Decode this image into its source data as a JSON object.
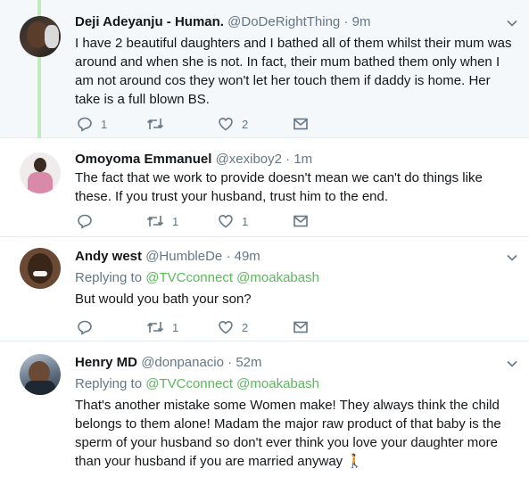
{
  "tweets": [
    {
      "name": "Deji Adeyanju - Human.",
      "handle": "@DoDeRightThing",
      "time": "· 9m",
      "text": "I have 2 beautiful daughters and I bathed all of them whilst their mum was around and when she is not. In fact, their mum bathed them only when I am not around cos they won't let her touch them if daddy is home. Her take is a full blown BS.",
      "reply_count": "1",
      "retweet_count": "",
      "like_count": "2"
    },
    {
      "name": "Omoyoma Emmanuel",
      "handle": "@xexiboy2",
      "time": "· 1m",
      "text": "The fact that we  work to provide doesn't mean we can't do things like these. If you trust your husband, trust him to the end.",
      "reply_count": "",
      "retweet_count": "1",
      "like_count": "1"
    },
    {
      "name": "Andy west",
      "handle": "@HumbleDe",
      "time": "· 49m",
      "replying_prefix": "Replying to",
      "mention1": "@TVCconnect",
      "mention2": "@moakabash",
      "text": "But would you bath your son?",
      "reply_count": "",
      "retweet_count": "1",
      "like_count": "2"
    },
    {
      "name": "Henry MD",
      "handle": "@donpanacio",
      "time": "· 52m",
      "replying_prefix": "Replying to",
      "mention1": "@TVCconnect",
      "mention2": "@moakabash",
      "text": "That's another mistake some Women make! They always think the child belongs to them alone! Madam the major raw product of that baby is the sperm of your husband so don't ever think you love your daughter more than your husband if you are married anyway 🚶",
      "reply_count": "",
      "retweet_count": "",
      "like_count": ""
    }
  ],
  "icons": {
    "reply": "reply-icon",
    "retweet": "retweet-icon",
    "like": "heart-icon",
    "dm": "envelope-icon",
    "caret": "chevron-down-icon"
  },
  "colors": {
    "thread_line": "#c4e8c0",
    "mention": "#5cb85c",
    "secondary_text": "#657786",
    "highlight_bg": "#f5f8fa"
  }
}
